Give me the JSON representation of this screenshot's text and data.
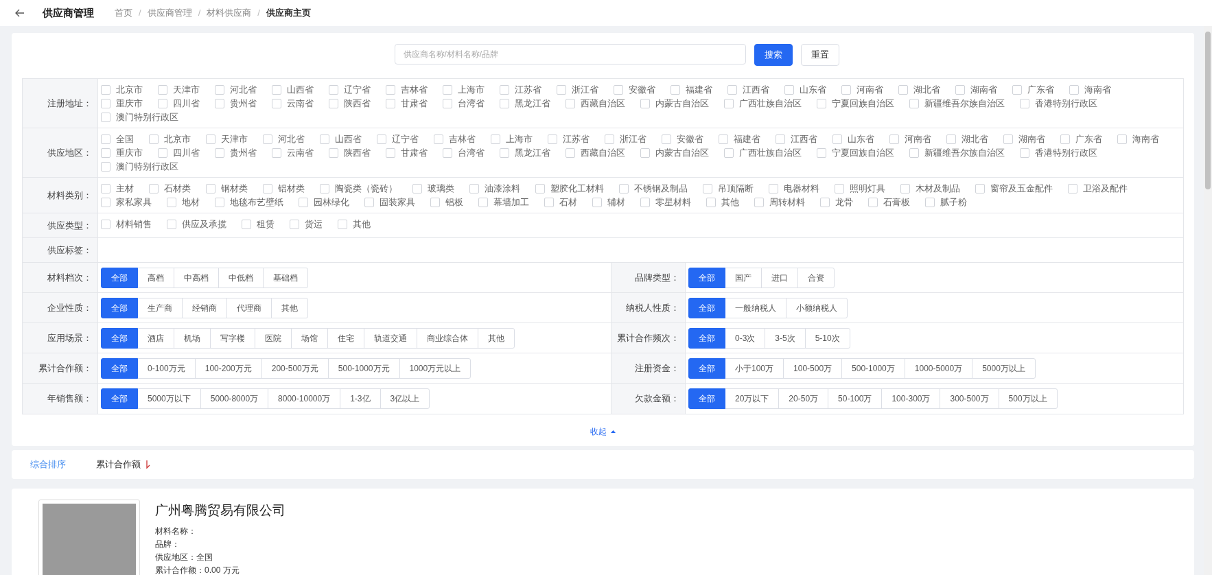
{
  "header": {
    "title": "供应商管理",
    "separator": "/",
    "breadcrumb": [
      {
        "text": "首页",
        "current": false
      },
      {
        "text": "供应商管理",
        "current": false
      },
      {
        "text": "材料供应商",
        "current": false
      },
      {
        "text": "供应商主页",
        "current": true
      }
    ]
  },
  "search": {
    "placeholder": "供应商名称/材料名称/品牌",
    "buttons": [
      {
        "text": "搜索",
        "primary": true
      },
      {
        "text": "重置",
        "primary": false
      }
    ]
  },
  "checkbox_filters": [
    {
      "label": "注册地址：",
      "options": [
        {
          "text": "北京市",
          "checked": false
        },
        {
          "text": "天津市",
          "checked": false
        },
        {
          "text": "河北省",
          "checked": false
        },
        {
          "text": "山西省",
          "checked": false
        },
        {
          "text": "辽宁省",
          "checked": false
        },
        {
          "text": "吉林省",
          "checked": false
        },
        {
          "text": "上海市",
          "checked": false
        },
        {
          "text": "江苏省",
          "checked": false
        },
        {
          "text": "浙江省",
          "checked": false
        },
        {
          "text": "安徽省",
          "checked": false
        },
        {
          "text": "福建省",
          "checked": false
        },
        {
          "text": "江西省",
          "checked": false
        },
        {
          "text": "山东省",
          "checked": false
        },
        {
          "text": "河南省",
          "checked": false
        },
        {
          "text": "湖北省",
          "checked": false
        },
        {
          "text": "湖南省",
          "checked": false
        },
        {
          "text": "广东省",
          "checked": false
        },
        {
          "text": "海南省",
          "checked": false
        },
        {
          "text": "重庆市",
          "checked": false
        },
        {
          "text": "四川省",
          "checked": false
        },
        {
          "text": "贵州省",
          "checked": false
        },
        {
          "text": "云南省",
          "checked": false
        },
        {
          "text": "陕西省",
          "checked": false
        },
        {
          "text": "甘肃省",
          "checked": false
        },
        {
          "text": "台湾省",
          "checked": false
        },
        {
          "text": "黑龙江省",
          "checked": false
        },
        {
          "text": "西藏自治区",
          "checked": false
        },
        {
          "text": "内蒙古自治区",
          "checked": false
        },
        {
          "text": "广西壮族自治区",
          "checked": false
        },
        {
          "text": "宁夏回族自治区",
          "checked": false
        },
        {
          "text": "新疆维吾尔族自治区",
          "checked": false
        },
        {
          "text": "香港特别行政区",
          "checked": false
        },
        {
          "text": "澳门特别行政区",
          "checked": false
        }
      ]
    },
    {
      "label": "供应地区：",
      "options": [
        {
          "text": "全国",
          "checked": false
        },
        {
          "text": "北京市",
          "checked": false
        },
        {
          "text": "天津市",
          "checked": false
        },
        {
          "text": "河北省",
          "checked": false
        },
        {
          "text": "山西省",
          "checked": false
        },
        {
          "text": "辽宁省",
          "checked": false
        },
        {
          "text": "吉林省",
          "checked": false
        },
        {
          "text": "上海市",
          "checked": false
        },
        {
          "text": "江苏省",
          "checked": false
        },
        {
          "text": "浙江省",
          "checked": false
        },
        {
          "text": "安徽省",
          "checked": false
        },
        {
          "text": "福建省",
          "checked": false
        },
        {
          "text": "江西省",
          "checked": false
        },
        {
          "text": "山东省",
          "checked": false
        },
        {
          "text": "河南省",
          "checked": false
        },
        {
          "text": "湖北省",
          "checked": false
        },
        {
          "text": "湖南省",
          "checked": false
        },
        {
          "text": "广东省",
          "checked": false
        },
        {
          "text": "海南省",
          "checked": false
        },
        {
          "text": "重庆市",
          "checked": false
        },
        {
          "text": "四川省",
          "checked": false
        },
        {
          "text": "贵州省",
          "checked": false
        },
        {
          "text": "云南省",
          "checked": false
        },
        {
          "text": "陕西省",
          "checked": false
        },
        {
          "text": "甘肃省",
          "checked": false
        },
        {
          "text": "台湾省",
          "checked": false
        },
        {
          "text": "黑龙江省",
          "checked": false
        },
        {
          "text": "西藏自治区",
          "checked": false
        },
        {
          "text": "内蒙古自治区",
          "checked": false
        },
        {
          "text": "广西壮族自治区",
          "checked": false
        },
        {
          "text": "宁夏回族自治区",
          "checked": false
        },
        {
          "text": "新疆维吾尔族自治区",
          "checked": false
        },
        {
          "text": "香港特别行政区",
          "checked": false
        },
        {
          "text": "澳门特别行政区",
          "checked": false
        }
      ]
    },
    {
      "label": "材料类别：",
      "options": [
        {
          "text": "主材",
          "checked": false
        },
        {
          "text": "石材类",
          "checked": false
        },
        {
          "text": "钢材类",
          "checked": false
        },
        {
          "text": "铝材类",
          "checked": false
        },
        {
          "text": "陶瓷类（瓷砖）",
          "checked": false
        },
        {
          "text": "玻璃类",
          "checked": false
        },
        {
          "text": "油漆涂料",
          "checked": false
        },
        {
          "text": "塑胶化工材料",
          "checked": false
        },
        {
          "text": "不锈钢及制品",
          "checked": false
        },
        {
          "text": "吊顶隔断",
          "checked": false
        },
        {
          "text": "电器材料",
          "checked": false
        },
        {
          "text": "照明灯具",
          "checked": false
        },
        {
          "text": "木材及制品",
          "checked": false
        },
        {
          "text": "窗帘及五金配件",
          "checked": false
        },
        {
          "text": "卫浴及配件",
          "checked": false
        },
        {
          "text": "家私家具",
          "checked": false
        },
        {
          "text": "地材",
          "checked": false
        },
        {
          "text": "地毯布艺壁纸",
          "checked": false
        },
        {
          "text": "园林绿化",
          "checked": false
        },
        {
          "text": "固装家具",
          "checked": false
        },
        {
          "text": "铝板",
          "checked": false
        },
        {
          "text": "幕墙加工",
          "checked": false
        },
        {
          "text": "石材",
          "checked": false
        },
        {
          "text": "辅材",
          "checked": false
        },
        {
          "text": "零星材料",
          "checked": false
        },
        {
          "text": "其他",
          "checked": false
        },
        {
          "text": "周转材料",
          "checked": false
        },
        {
          "text": "龙骨",
          "checked": false
        },
        {
          "text": "石膏板",
          "checked": false
        },
        {
          "text": "腻子粉",
          "checked": false
        }
      ]
    },
    {
      "label": "供应类型：",
      "options": [
        {
          "text": "材料销售",
          "checked": false
        },
        {
          "text": "供应及承揽",
          "checked": false
        },
        {
          "text": "租赁",
          "checked": false
        },
        {
          "text": "货运",
          "checked": false
        },
        {
          "text": "其他",
          "checked": false
        }
      ]
    },
    {
      "label": "供应标签："
    }
  ],
  "segment_rows": [
    [
      {
        "label": "材料档次：",
        "options": [
          {
            "text": "全部",
            "selected": true
          },
          {
            "text": "高档",
            "selected": false
          },
          {
            "text": "中高档",
            "selected": false
          },
          {
            "text": "中低档",
            "selected": false
          },
          {
            "text": "基础档",
            "selected": false
          }
        ]
      },
      {
        "label": "品牌类型：",
        "options": [
          {
            "text": "全部",
            "selected": true
          },
          {
            "text": "国产",
            "selected": false
          },
          {
            "text": "进口",
            "selected": false
          },
          {
            "text": "合资",
            "selected": false
          }
        ]
      }
    ],
    [
      {
        "label": "企业性质：",
        "options": [
          {
            "text": "全部",
            "selected": true
          },
          {
            "text": "生产商",
            "selected": false
          },
          {
            "text": "经销商",
            "selected": false
          },
          {
            "text": "代理商",
            "selected": false
          },
          {
            "text": "其他",
            "selected": false
          }
        ]
      },
      {
        "label": "纳税人性质：",
        "options": [
          {
            "text": "全部",
            "selected": true
          },
          {
            "text": "一般纳税人",
            "selected": false
          },
          {
            "text": "小额纳税人",
            "selected": false
          }
        ]
      }
    ],
    [
      {
        "label": "应用场景：",
        "options": [
          {
            "text": "全部",
            "selected": true
          },
          {
            "text": "酒店",
            "selected": false
          },
          {
            "text": "机场",
            "selected": false
          },
          {
            "text": "写字楼",
            "selected": false
          },
          {
            "text": "医院",
            "selected": false
          },
          {
            "text": "场馆",
            "selected": false
          },
          {
            "text": "住宅",
            "selected": false
          },
          {
            "text": "轨道交通",
            "selected": false
          },
          {
            "text": "商业综合体",
            "selected": false
          },
          {
            "text": "其他",
            "selected": false
          }
        ]
      },
      {
        "label": "累计合作频次：",
        "options": [
          {
            "text": "全部",
            "selected": true
          },
          {
            "text": "0-3次",
            "selected": false
          },
          {
            "text": "3-5次",
            "selected": false
          },
          {
            "text": "5-10次",
            "selected": false
          }
        ]
      }
    ],
    [
      {
        "label": "累计合作额：",
        "options": [
          {
            "text": "全部",
            "selected": true
          },
          {
            "text": "0-100万元",
            "selected": false
          },
          {
            "text": "100-200万元",
            "selected": false
          },
          {
            "text": "200-500万元",
            "selected": false
          },
          {
            "text": "500-1000万元",
            "selected": false
          },
          {
            "text": "1000万元以上",
            "selected": false
          }
        ]
      },
      {
        "label": "注册资金：",
        "options": [
          {
            "text": "全部",
            "selected": true
          },
          {
            "text": "小于100万",
            "selected": false
          },
          {
            "text": "100-500万",
            "selected": false
          },
          {
            "text": "500-1000万",
            "selected": false
          },
          {
            "text": "1000-5000万",
            "selected": false
          },
          {
            "text": "5000万以上",
            "selected": false
          }
        ]
      }
    ],
    [
      {
        "label": "年销售额：",
        "options": [
          {
            "text": "全部",
            "selected": true
          },
          {
            "text": "5000万以下",
            "selected": false
          },
          {
            "text": "5000-8000万",
            "selected": false
          },
          {
            "text": "8000-10000万",
            "selected": false
          },
          {
            "text": "1-3亿",
            "selected": false
          },
          {
            "text": "3亿以上",
            "selected": false
          }
        ]
      },
      {
        "label": "欠款金额：",
        "options": [
          {
            "text": "全部",
            "selected": true
          },
          {
            "text": "20万以下",
            "selected": false
          },
          {
            "text": "20-50万",
            "selected": false
          },
          {
            "text": "50-100万",
            "selected": false
          },
          {
            "text": "100-300万",
            "selected": false
          },
          {
            "text": "300-500万",
            "selected": false
          },
          {
            "text": "500万以上",
            "selected": false
          }
        ]
      }
    ]
  ],
  "collapse": {
    "text": "收起",
    "expanded": true
  },
  "sort_tabs": [
    {
      "text": "综合排序",
      "selected": true,
      "arrow": false
    },
    {
      "text": "累计合作额",
      "selected": false,
      "arrow": true
    }
  ],
  "supplier": {
    "name": "广州粤腾贸易有限公司",
    "fields": [
      {
        "label": "材料名称："
      },
      {
        "label": "品牌："
      },
      {
        "label": "供应地区：",
        "value": "全国"
      },
      {
        "label": "累计合作额：",
        "value": "0.00 万元"
      }
    ]
  }
}
